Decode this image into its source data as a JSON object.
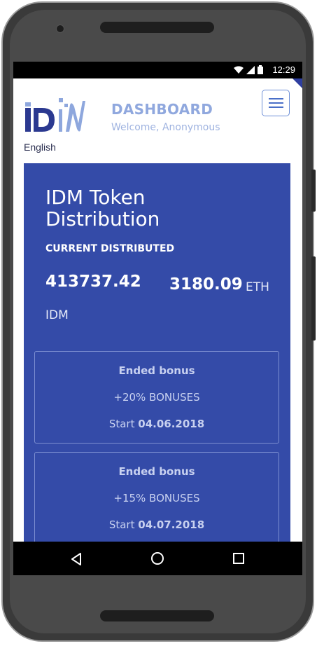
{
  "status_bar": {
    "time": "12:29",
    "icons": [
      "wifi-icon",
      "signal-icon",
      "battery-icon"
    ]
  },
  "header": {
    "logo_alt": "IDM",
    "language": "English",
    "title": "DASHBOARD",
    "subtitle": "Welcome, Anonymous",
    "menu_icon": "hamburger-icon"
  },
  "distribution": {
    "title": "IDM Token Distribution",
    "current_label": "CURRENT DISTRIBUTED",
    "idm_amount": "413737.42",
    "idm_unit": "IDM",
    "eth_amount": "3180.09",
    "eth_unit": "ETH"
  },
  "bonuses": [
    {
      "status": "Ended bonus",
      "percent": "+20% BONUSES",
      "start_label": "Start",
      "start_date": "04.06.2018"
    },
    {
      "status": "Ended bonus",
      "percent": "+15% BONUSES",
      "start_label": "Start",
      "start_date": "04.07.2018"
    }
  ],
  "nav_bar": {
    "icons": [
      "back-icon",
      "home-icon",
      "recent-apps-icon"
    ]
  },
  "colors": {
    "panel": "#344ba8",
    "accent": "#90a8de",
    "logo_dark": "#2b3990",
    "logo_light": "#8ea7dd"
  }
}
